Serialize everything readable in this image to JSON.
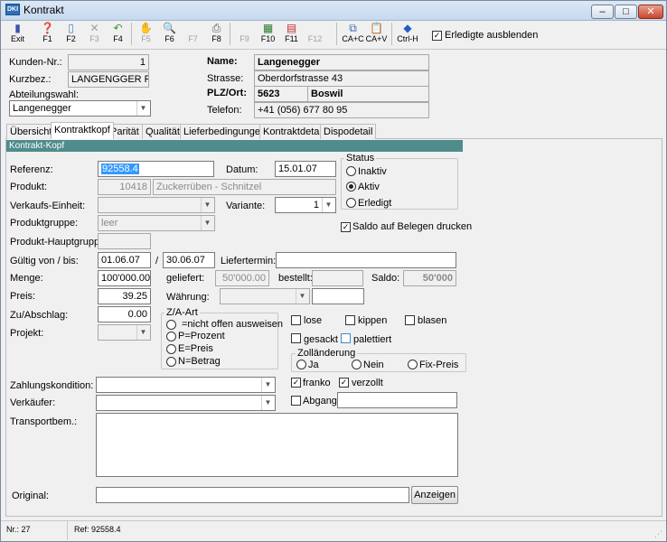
{
  "window": {
    "title": "Kontrakt",
    "icon_text": "DKI"
  },
  "toolbar": {
    "buttons": [
      {
        "label": "Exit"
      },
      {
        "label": "F1"
      },
      {
        "label": "F2"
      },
      {
        "label": "F3"
      },
      {
        "label": "F4"
      },
      {
        "label": "F5"
      },
      {
        "label": "F6"
      },
      {
        "label": "F7"
      },
      {
        "label": "F8"
      },
      {
        "label": "F9"
      },
      {
        "label": "F10"
      },
      {
        "label": "F11"
      },
      {
        "label": "F12"
      },
      {
        "label": "CA+C"
      },
      {
        "label": "CA+V"
      },
      {
        "label": "Ctrl-H"
      }
    ],
    "hide_done_label": "Erledigte ausblenden",
    "hide_done_checked": "✓"
  },
  "customer": {
    "nr_label": "Kunden-Nr.:",
    "nr_value": "1",
    "short_label": "Kurzbez.:",
    "short_value": "LANGENGGER PAU",
    "dept_label": "Abteilungswahl:",
    "dept_value": "Langenegger",
    "name_label": "Name:",
    "name_value": "Langenegger",
    "street_label": "Strasse:",
    "street_value": "Oberdorfstrasse 43",
    "zip_label": "PLZ/Ort:",
    "zip_value": "5623",
    "city_value": "Boswil",
    "phone_label": "Telefon:",
    "phone_value": "+41 (056) 677 80 95"
  },
  "tabs": [
    "Übersicht",
    "Kontraktkopf",
    "Parität",
    "Qualität",
    "Lieferbedingungen",
    "Kontraktdetail",
    "Dispodetail"
  ],
  "section_title": "Kontrakt-Kopf",
  "form": {
    "referenz_label": "Referenz:",
    "referenz_value": "92558.4",
    "datum_label": "Datum:",
    "datum_value": "15.01.07",
    "produkt_label": "Produkt:",
    "produkt_nr": "10418",
    "produkt_name": "Zuckerrüben - Schnitzel",
    "verkaufseinheit_label": "Verkaufs-Einheit:",
    "variante_label": "Variante:",
    "variante_value": "1",
    "produktgruppe_label": "Produktgruppe:",
    "produktgruppe_value": "leer",
    "hauptgruppe_label": "Produkt-Hauptgruppe:",
    "gueltig_label": "Gültig von / bis:",
    "gueltig_von": "01.06.07",
    "slash": "/",
    "gueltig_bis": "30.06.07",
    "liefertermin_label": "Liefertermin:",
    "menge_label": "Menge:",
    "menge_value": "100'000.00",
    "geliefert_label": "geliefert:",
    "geliefert_value": "50'000.00",
    "bestellt_label": "bestellt:",
    "saldo_label": "Saldo:",
    "saldo_value": "50'000",
    "preis_label": "Preis:",
    "preis_value": "39.25",
    "waehrung_label": "Währung:",
    "zuab_label": "Zu/Abschlag:",
    "zuab_value": "0.00",
    "projekt_label": "Projekt:",
    "zahlungskondition_label": "Zahlungskondition:",
    "verkaeufer_label": "Verkäufer:",
    "transportbem_label": "Transportbem.:",
    "original_label": "Original:",
    "anzeigen_label": "Anzeigen"
  },
  "status": {
    "title": "Status",
    "options": [
      "Inaktiv",
      "Aktiv",
      "Erledigt"
    ],
    "selected": "Aktiv"
  },
  "saldo_print": {
    "label": "Saldo auf Belegen drucken",
    "check": "✓"
  },
  "za_art": {
    "title": "Z/A-Art",
    "options": [
      "=nicht offen ausweisen",
      "P=Prozent",
      "E=Preis",
      "N=Betrag"
    ]
  },
  "packaging": {
    "lose": "lose",
    "kippen": "kippen",
    "blasen": "blasen",
    "gesackt": "gesackt",
    "palettiert": "palettiert"
  },
  "zollaenderung": {
    "title": "Zolländerung",
    "options": [
      "Ja",
      "Nein",
      "Fix-Preis"
    ]
  },
  "delivery": {
    "franko": "franko",
    "verzollt": "verzollt",
    "abgang": "Abgang:",
    "check": "✓"
  },
  "statusbar": {
    "nr": "Nr.: 27",
    "ref": "Ref: 92558.4"
  }
}
